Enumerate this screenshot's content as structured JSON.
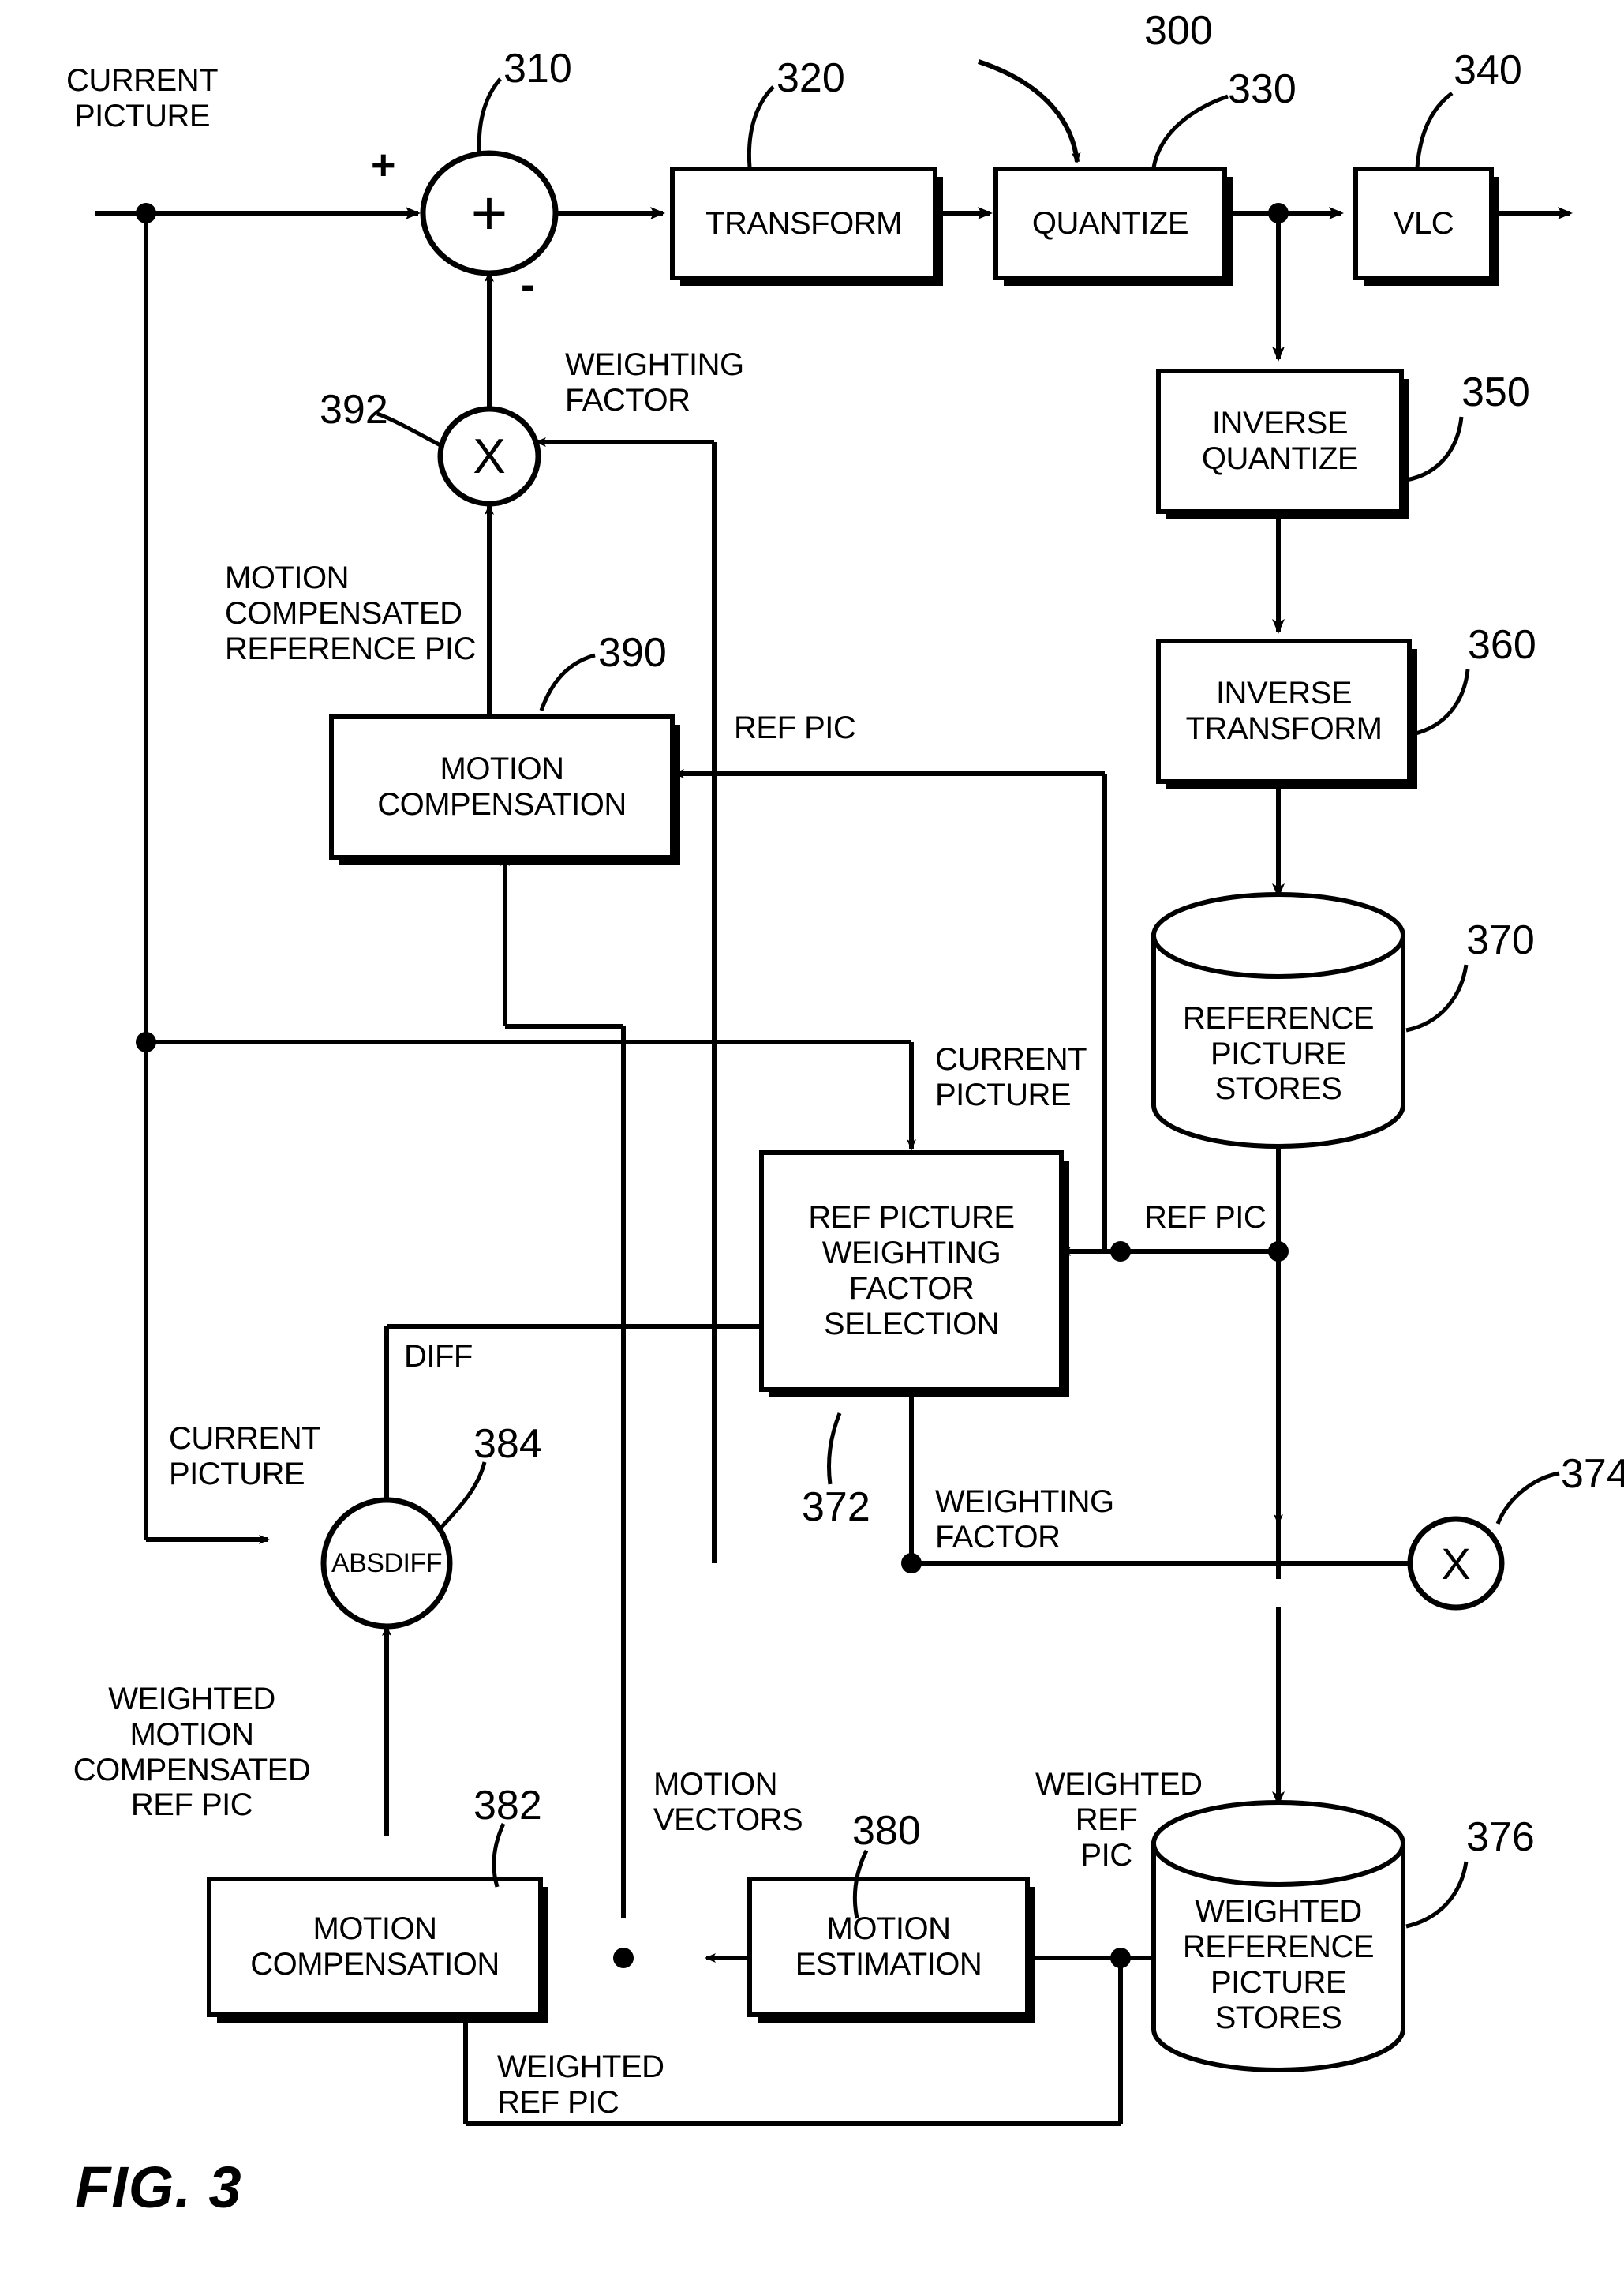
{
  "figure": {
    "caption": "FIG. 3",
    "overall_ref": "300"
  },
  "blocks": [
    {
      "id": "transform",
      "label": "TRANSFORM",
      "ref": "320"
    },
    {
      "id": "quantize",
      "label": "QUANTIZE",
      "ref": "330"
    },
    {
      "id": "vlc",
      "label": "VLC",
      "ref": "340"
    },
    {
      "id": "inverse-quantize",
      "label": "INVERSE\nQUANTIZE",
      "ref": "350"
    },
    {
      "id": "inverse-transform",
      "label": "INVERSE\nTRANSFORM",
      "ref": "360"
    },
    {
      "id": "reference-picture-stores",
      "label": "REFERENCE\nPICTURE\nSTORES",
      "ref": "370"
    },
    {
      "id": "motion-compensation-390",
      "label": "MOTION\nCOMPENSATION",
      "ref": "390"
    },
    {
      "id": "ref-picture-weighting-factor-selection",
      "label": "REF PICTURE\nWEIGHTING\nFACTOR\nSELECTION",
      "ref": "372"
    },
    {
      "id": "weighted-reference-picture-stores",
      "label": "WEIGHTED\nREFERENCE\nPICTURE\nSTORES",
      "ref": "376"
    },
    {
      "id": "motion-estimation",
      "label": "MOTION\nESTIMATION",
      "ref": "380"
    },
    {
      "id": "motion-compensation-382",
      "label": "MOTION\nCOMPENSATION",
      "ref": "382"
    }
  ],
  "operators": [
    {
      "id": "adder-310",
      "symbol": "+",
      "ref": "310",
      "plus_sign": "+",
      "minus_sign": "-"
    },
    {
      "id": "multiplier-392",
      "symbol": "X",
      "ref": "392"
    },
    {
      "id": "absdiff-384",
      "symbol": "ABSDIFF",
      "ref": "384"
    },
    {
      "id": "multiplier-374",
      "symbol": "X",
      "ref": "374"
    }
  ],
  "signal_labels": {
    "current_picture_input": "CURRENT\nPICTURE",
    "weighting_factor_to_mult392": "WEIGHTING\nFACTOR",
    "motion_compensated_reference_pic": "MOTION\nCOMPENSATED\nREFERENCE PIC",
    "ref_pic_to_mc390": "REF PIC",
    "current_picture_to_selection": "CURRENT\nPICTURE",
    "ref_pic_to_selection": "REF PIC",
    "diff": "DIFF",
    "current_picture_to_absdiff": "CURRENT\nPICTURE",
    "weighting_factor_out": "WEIGHTING\nFACTOR",
    "weighted_motion_compensated_ref_pic": "WEIGHTED\nMOTION\nCOMPENSATED\nREF PIC",
    "motion_vectors": "MOTION\nVECTORS",
    "weighted_ref_pic_to_me": "WEIGHTED\nREF\nPIC",
    "weighted_ref_pic_to_mc382": "WEIGHTED\nREF PIC"
  },
  "colors": {
    "ink": "#000000",
    "paper": "#ffffff"
  }
}
